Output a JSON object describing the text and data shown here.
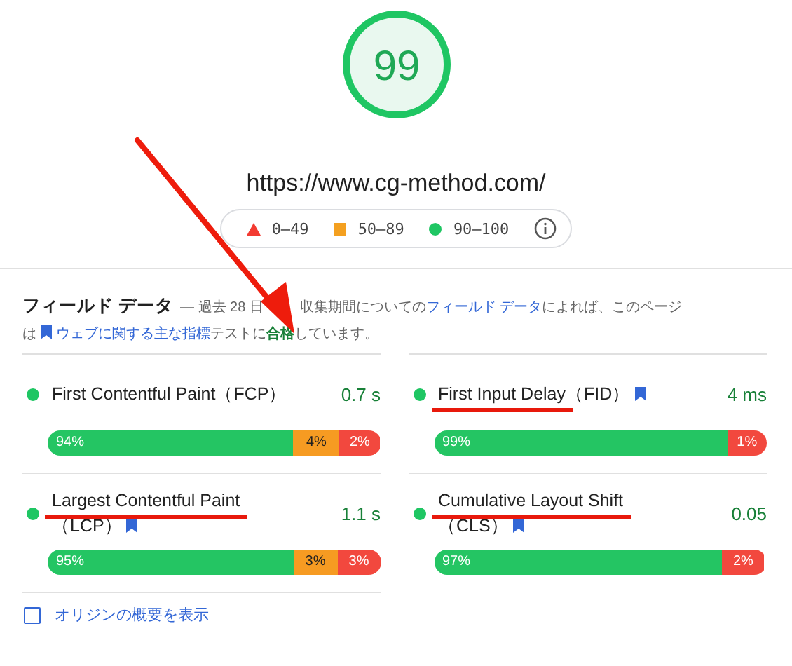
{
  "score": {
    "value": "99"
  },
  "url": "https://www.cg-method.com/",
  "legend": [
    {
      "kind": "poor",
      "label": "0–49",
      "color": "#f33b32"
    },
    {
      "kind": "average",
      "label": "50–89",
      "color": "#f4a020"
    },
    {
      "kind": "good",
      "label": "90–100",
      "color": "#1fc663"
    }
  ],
  "field_data": {
    "title": "フィールド データ",
    "intro_before": "— 過去 28 日",
    "intro_after": "収集期間についての",
    "link": "フィールド データ",
    "intro_end": "によれば、このページ",
    "line2_start": "は",
    "cwv_link": "ウェブに関する主な指標",
    "line2_mid": "テストに",
    "result": "合格",
    "line2_end": "しています。"
  },
  "metrics": [
    {
      "name": "First Contentful Paint",
      "abbr": "（FCP）",
      "core": false,
      "underlined": false,
      "value": "0.7 s",
      "color": "#1fc663",
      "segments": [
        {
          "kind": "good",
          "label": "94%"
        },
        {
          "kind": "average",
          "label": "4%"
        },
        {
          "kind": "poor",
          "label": "2%"
        }
      ]
    },
    {
      "name": "First Input Delay",
      "abbr": "（FID）",
      "core": true,
      "underlined": true,
      "value": "4 ms",
      "color": "#1fc663",
      "segments": [
        {
          "kind": "good",
          "label": "99%"
        },
        {
          "kind": "poor",
          "label": "1%"
        }
      ]
    },
    {
      "name": "Largest Contentful Paint",
      "abbr": "（LCP）",
      "core": true,
      "underlined": true,
      "value": "1.1 s",
      "color": "#1fc663",
      "segments": [
        {
          "kind": "good",
          "label": "95%"
        },
        {
          "kind": "average",
          "label": "3%"
        },
        {
          "kind": "poor",
          "label": "3%"
        }
      ]
    },
    {
      "name": "Cumulative Layout Shift",
      "abbr": "（CLS）",
      "core": true,
      "underlined": true,
      "value": "0.05",
      "color": "#1fc663",
      "segments": [
        {
          "kind": "good",
          "label": "97%"
        },
        {
          "kind": "poor",
          "label": "2%"
        }
      ]
    }
  ],
  "origin_summary": {
    "label": "オリジンの概要を表示",
    "checked": false
  },
  "annotation_arrow": true
}
